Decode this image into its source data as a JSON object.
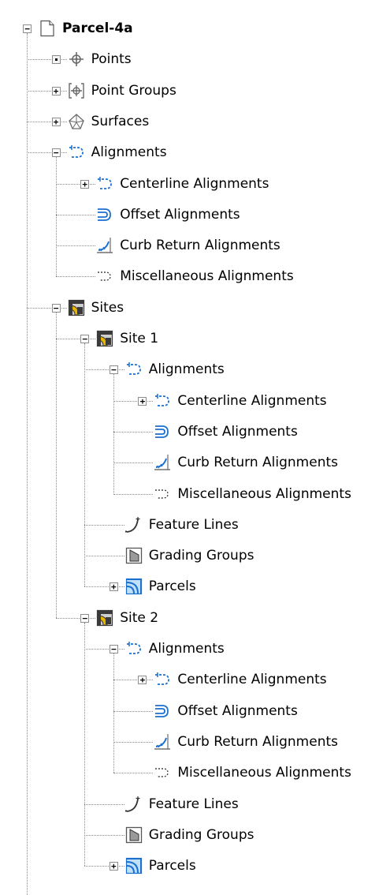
{
  "tree": {
    "nodes": [
      {
        "label": "Parcel-4a",
        "level": 0,
        "icon": "drawing-icon",
        "state": "expanded",
        "bold": true
      },
      {
        "label": "Points",
        "level": 1,
        "icon": "point-icon",
        "state": "leafbox"
      },
      {
        "label": "Point Groups",
        "level": 1,
        "icon": "point-group-icon",
        "state": "collapsed"
      },
      {
        "label": "Surfaces",
        "level": 1,
        "icon": "surface-icon",
        "state": "collapsed"
      },
      {
        "label": "Alignments",
        "level": 1,
        "icon": "alignment-icon",
        "state": "expanded"
      },
      {
        "label": "Centerline Alignments",
        "level": 2,
        "icon": "alignment-icon",
        "state": "collapsed"
      },
      {
        "label": "Offset Alignments",
        "level": 2,
        "icon": "offset-alignment-icon",
        "state": "none"
      },
      {
        "label": "Curb Return Alignments",
        "level": 2,
        "icon": "curb-return-icon",
        "state": "none"
      },
      {
        "label": "Miscellaneous Alignments",
        "level": 2,
        "icon": "misc-alignment-icon",
        "state": "none"
      },
      {
        "label": "Sites",
        "level": 1,
        "icon": "sites-icon",
        "state": "expanded"
      },
      {
        "label": "Site 1",
        "level": 2,
        "icon": "site-icon",
        "state": "expanded"
      },
      {
        "label": "Alignments",
        "level": 3,
        "icon": "alignment-icon",
        "state": "expanded"
      },
      {
        "label": "Centerline Alignments",
        "level": 4,
        "icon": "alignment-icon",
        "state": "collapsed"
      },
      {
        "label": "Offset Alignments",
        "level": 4,
        "icon": "offset-alignment-icon",
        "state": "none"
      },
      {
        "label": "Curb Return Alignments",
        "level": 4,
        "icon": "curb-return-icon",
        "state": "none"
      },
      {
        "label": "Miscellaneous Alignments",
        "level": 4,
        "icon": "misc-alignment-icon",
        "state": "none"
      },
      {
        "label": "Feature Lines",
        "level": 3,
        "icon": "feature-line-icon",
        "state": "none"
      },
      {
        "label": "Grading Groups",
        "level": 3,
        "icon": "grading-group-icon",
        "state": "none"
      },
      {
        "label": "Parcels",
        "level": 3,
        "icon": "parcel-icon",
        "state": "collapsed"
      },
      {
        "label": "Site 2",
        "level": 2,
        "icon": "site-icon",
        "state": "expanded"
      },
      {
        "label": "Alignments",
        "level": 3,
        "icon": "alignment-icon",
        "state": "expanded"
      },
      {
        "label": "Centerline Alignments",
        "level": 4,
        "icon": "alignment-icon",
        "state": "collapsed"
      },
      {
        "label": "Offset Alignments",
        "level": 4,
        "icon": "offset-alignment-icon",
        "state": "none"
      },
      {
        "label": "Curb Return Alignments",
        "level": 4,
        "icon": "curb-return-icon",
        "state": "none"
      },
      {
        "label": "Miscellaneous Alignments",
        "level": 4,
        "icon": "misc-alignment-icon",
        "state": "none"
      },
      {
        "label": "Feature Lines",
        "level": 3,
        "icon": "feature-line-icon",
        "state": "none"
      },
      {
        "label": "Grading Groups",
        "level": 3,
        "icon": "grading-group-icon",
        "state": "none"
      },
      {
        "label": "Parcels",
        "level": 3,
        "icon": "parcel-icon",
        "state": "collapsed"
      }
    ]
  },
  "colors": {
    "alignment_blue": "#1a6fd1",
    "site_yellow": "#e8b400",
    "site_dark": "#3a3a3a",
    "icon_gray": "#6a6a6a"
  }
}
